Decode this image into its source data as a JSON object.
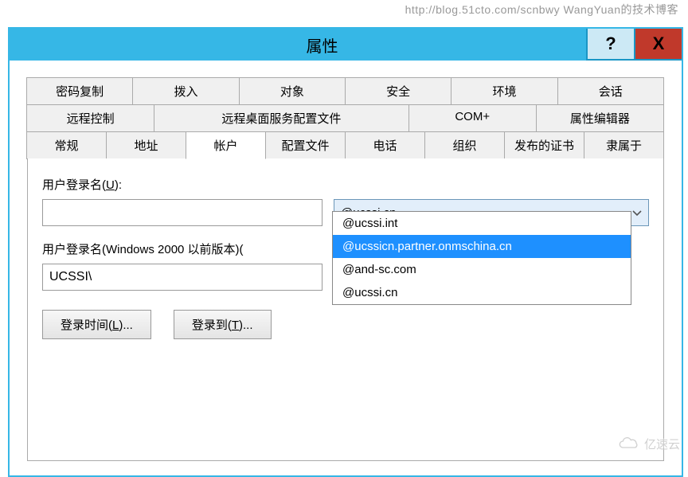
{
  "watermark": "http://blog.51cto.com/scnbwy WangYuan的技术博客",
  "logo_wm": "亿速云",
  "titlebar": {
    "title": "           属性",
    "help": "?",
    "close": "X"
  },
  "tabs": {
    "row1": [
      "密码复制",
      "拨入",
      "对象",
      "安全",
      "环境",
      "会话"
    ],
    "row2": [
      "远程控制",
      "远程桌面服务配置文件",
      "COM+",
      "属性编辑器"
    ],
    "row3": [
      "常规",
      "地址",
      "帐户",
      "配置文件",
      "电话",
      "组织",
      "发布的证书",
      "隶属于"
    ]
  },
  "account": {
    "login_label_pre": "用户登录名(",
    "login_label_u": "U",
    "login_label_post": "):",
    "login_value": "",
    "domain_selected": "@ucssi.cn",
    "dropdown": {
      "items": [
        "@ucssi.int",
        "@ucssicn.partner.onmschina.cn",
        "@and-sc.com",
        "@ucssi.cn"
      ],
      "selected_index": 1
    },
    "legacy_label": "用户登录名(Windows 2000 以前版本)(",
    "legacy_value": "UCSSI\\",
    "btn_logon_hours_pre": "登录时间(",
    "btn_logon_hours_u": "L",
    "btn_logon_hours_post": ")...",
    "btn_logon_to_pre": "登录到(",
    "btn_logon_to_u": "T",
    "btn_logon_to_post": ")..."
  }
}
